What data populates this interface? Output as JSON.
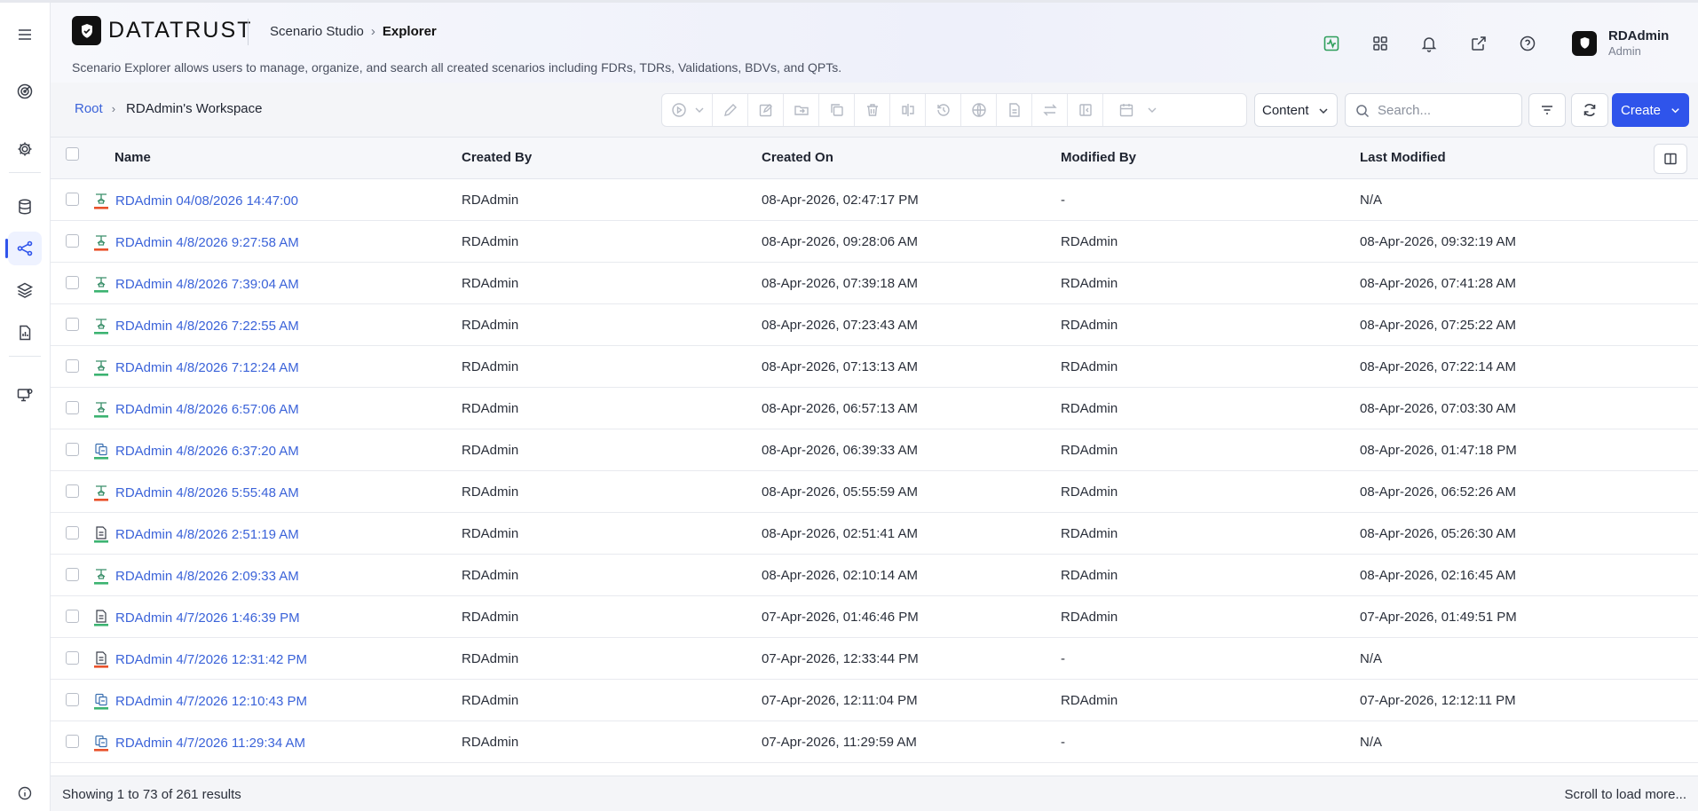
{
  "app": {
    "logo_text": "DATATRUST",
    "studio": "Scenario Studio",
    "page": "Explorer",
    "subtitle": "Scenario Explorer allows users to manage, organize, and search all created scenarios including FDRs, TDRs, Validations, BDVs, and QPTs."
  },
  "user": {
    "name": "RDAdmin",
    "role": "Admin"
  },
  "breadcrumb": {
    "root": "Root",
    "workspace": "RDAdmin's Workspace"
  },
  "toolbar": {
    "content_label": "Content",
    "search_placeholder": "Search...",
    "create_label": "Create"
  },
  "table": {
    "headers": {
      "name": "Name",
      "created_by": "Created By",
      "created_on": "Created On",
      "modified_by": "Modified By",
      "last_modified": "Last Modified"
    },
    "rows": [
      {
        "icon": "network-scenario-icon",
        "status": "red",
        "name": "RDAdmin 04/08/2026 14:47:00",
        "created_by": "RDAdmin",
        "created_on": "08-Apr-2026, 02:47:17 PM",
        "modified_by": "-",
        "last_modified": "N/A"
      },
      {
        "icon": "network-scenario-icon",
        "status": "red",
        "name": "RDAdmin 4/8/2026 9:27:58 AM",
        "created_by": "RDAdmin",
        "created_on": "08-Apr-2026, 09:28:06 AM",
        "modified_by": "RDAdmin",
        "last_modified": "08-Apr-2026, 09:32:19 AM"
      },
      {
        "icon": "network-scenario-icon",
        "status": "green",
        "name": "RDAdmin 4/8/2026 7:39:04 AM",
        "created_by": "RDAdmin",
        "created_on": "08-Apr-2026, 07:39:18 AM",
        "modified_by": "RDAdmin",
        "last_modified": "08-Apr-2026, 07:41:28 AM"
      },
      {
        "icon": "network-scenario-icon",
        "status": "green",
        "name": "RDAdmin 4/8/2026 7:22:55 AM",
        "created_by": "RDAdmin",
        "created_on": "08-Apr-2026, 07:23:43 AM",
        "modified_by": "RDAdmin",
        "last_modified": "08-Apr-2026, 07:25:22 AM"
      },
      {
        "icon": "network-scenario-icon",
        "status": "green",
        "name": "RDAdmin 4/8/2026 7:12:24 AM",
        "created_by": "RDAdmin",
        "created_on": "08-Apr-2026, 07:13:13 AM",
        "modified_by": "RDAdmin",
        "last_modified": "08-Apr-2026, 07:22:14 AM"
      },
      {
        "icon": "network-scenario-icon",
        "status": "green",
        "name": "RDAdmin 4/8/2026 6:57:06 AM",
        "created_by": "RDAdmin",
        "created_on": "08-Apr-2026, 06:57:13 AM",
        "modified_by": "RDAdmin",
        "last_modified": "08-Apr-2026, 07:03:30 AM"
      },
      {
        "icon": "compare-scenario-icon",
        "status": "green",
        "name": "RDAdmin 4/8/2026 6:37:20 AM",
        "created_by": "RDAdmin",
        "created_on": "08-Apr-2026, 06:39:33 AM",
        "modified_by": "RDAdmin",
        "last_modified": "08-Apr-2026, 01:47:18 PM"
      },
      {
        "icon": "network-scenario-icon",
        "status": "red",
        "name": "RDAdmin 4/8/2026 5:55:48 AM",
        "created_by": "RDAdmin",
        "created_on": "08-Apr-2026, 05:55:59 AM",
        "modified_by": "RDAdmin",
        "last_modified": "08-Apr-2026, 06:52:26 AM"
      },
      {
        "icon": "document-scenario-icon",
        "status": "green",
        "name": "RDAdmin 4/8/2026 2:51:19 AM",
        "created_by": "RDAdmin",
        "created_on": "08-Apr-2026, 02:51:41 AM",
        "modified_by": "RDAdmin",
        "last_modified": "08-Apr-2026, 05:26:30 AM"
      },
      {
        "icon": "network-scenario-icon",
        "status": "green",
        "name": "RDAdmin 4/8/2026 2:09:33 AM",
        "created_by": "RDAdmin",
        "created_on": "08-Apr-2026, 02:10:14 AM",
        "modified_by": "RDAdmin",
        "last_modified": "08-Apr-2026, 02:16:45 AM"
      },
      {
        "icon": "document-scenario-icon",
        "status": "green",
        "name": "RDAdmin 4/7/2026 1:46:39 PM",
        "created_by": "RDAdmin",
        "created_on": "07-Apr-2026, 01:46:46 PM",
        "modified_by": "RDAdmin",
        "last_modified": "07-Apr-2026, 01:49:51 PM"
      },
      {
        "icon": "document-scenario-icon",
        "status": "red",
        "name": "RDAdmin 4/7/2026 12:31:42 PM",
        "created_by": "RDAdmin",
        "created_on": "07-Apr-2026, 12:33:44 PM",
        "modified_by": "-",
        "last_modified": "N/A"
      },
      {
        "icon": "compare-scenario-icon",
        "status": "green",
        "name": "RDAdmin 4/7/2026 12:10:43 PM",
        "created_by": "RDAdmin",
        "created_on": "07-Apr-2026, 12:11:04 PM",
        "modified_by": "RDAdmin",
        "last_modified": "07-Apr-2026, 12:12:11 PM"
      },
      {
        "icon": "compare-scenario-icon",
        "status": "red",
        "name": "RDAdmin 4/7/2026 11:29:34 AM",
        "created_by": "RDAdmin",
        "created_on": "07-Apr-2026, 11:29:59 AM",
        "modified_by": "-",
        "last_modified": "N/A"
      }
    ]
  },
  "footer": {
    "results": "Showing 1 to 73 of 261 results",
    "scroll_hint": "Scroll to load more..."
  },
  "colors": {
    "accent": "#2f54eb",
    "link": "#3b63d9",
    "status_green": "#3cb371",
    "status_red": "#e8512a"
  }
}
